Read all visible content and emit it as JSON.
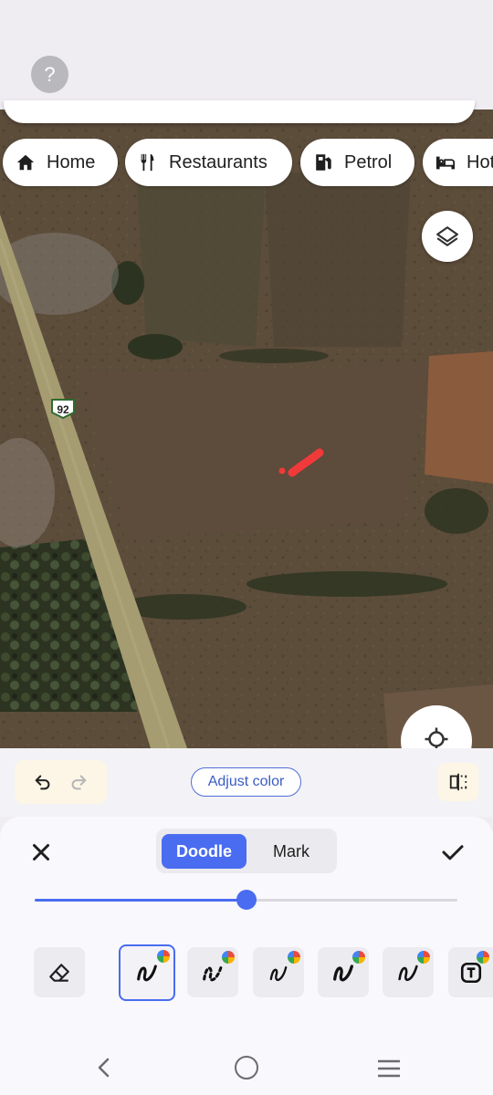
{
  "help": {
    "label": "?"
  },
  "chips": [
    {
      "label": "Home",
      "icon": "home-icon"
    },
    {
      "label": "Restaurants",
      "icon": "restaurant-icon"
    },
    {
      "label": "Petrol",
      "icon": "fuel-icon"
    },
    {
      "label": "Hot",
      "icon": "hotel-icon"
    }
  ],
  "map": {
    "road_shield": "92",
    "style": "satellite",
    "doodle_color": "#f03a3a"
  },
  "edit_toolbar": {
    "adjust_color_label": "Adjust color"
  },
  "doodle_panel": {
    "tabs": [
      {
        "label": "Doodle",
        "selected": true
      },
      {
        "label": "Mark",
        "selected": false
      }
    ],
    "brush_size": 0.5,
    "tools": [
      "eraser-tool",
      "pen-tool",
      "dotted-pen-tool",
      "pen-tool-2",
      "pen-tool-3",
      "pen-tool-4",
      "text-tool"
    ],
    "selected_tool": "pen-tool"
  },
  "colors": {
    "accent": "#4a6cf0",
    "toolbar_bg": "#fdf6e6"
  }
}
